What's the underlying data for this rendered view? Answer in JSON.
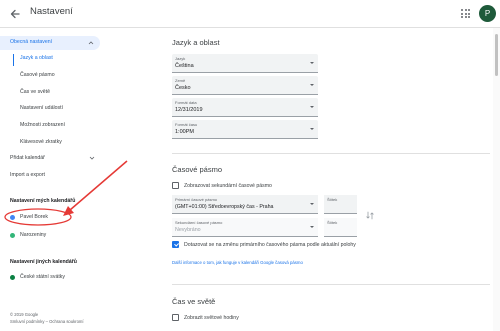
{
  "header": {
    "title": "Nastavení",
    "avatar_initial": "P"
  },
  "sidebar": {
    "general": {
      "label": "Obecná nastavení",
      "items": [
        {
          "label": "Jazyk a oblast",
          "active": true
        },
        {
          "label": "Časové pásmo"
        },
        {
          "label": "Čas ve světě"
        },
        {
          "label": "Nastavení událostí"
        },
        {
          "label": "Možnosti zobrazení"
        },
        {
          "label": "Klávesové zkratky"
        }
      ]
    },
    "add_calendar": "Přidat kalendář",
    "import_export": "Import a export",
    "my_calendars_heading": "Nastavení mých kalendářů",
    "my_calendars": [
      {
        "label": "Pavel Borek",
        "color": "#4285f4"
      },
      {
        "label": "Narozeniny",
        "color": "#33b679"
      }
    ],
    "other_calendars_heading": "Nastavení jiných kalendářů",
    "other_calendars": [
      {
        "label": "České státní svátky",
        "color": "#0b8043"
      }
    ],
    "footer": {
      "copyright": "© 2019 Google",
      "links": "Smluvní podmínky – Ochrana soukromí"
    }
  },
  "language_region": {
    "title": "Jazyk a oblast",
    "fields": [
      {
        "label": "Jazyk",
        "value": "Čeština"
      },
      {
        "label": "Země",
        "value": "Česko"
      },
      {
        "label": "Formát data",
        "value": "12/31/2019"
      },
      {
        "label": "Formát času",
        "value": "1:00PM"
      }
    ]
  },
  "timezone": {
    "title": "Časové pásmo",
    "secondary_checkbox": "Zobrazovat sekundární časové pásmo",
    "secondary_checked": false,
    "primary_label": "Primární časové pásmo",
    "primary_value": "(GMT+01:00) Středoevropský čas - Praha",
    "primary_tag_label": "Štítek",
    "secondary_label": "Sekundární časové pásmo",
    "secondary_value": "Nevybráno",
    "secondary_tag_label": "Štítek",
    "ask_checkbox": "Dotazovat se na změnu primárního časového pásma podle aktuální polohy",
    "ask_checked": true,
    "link": "Další informace o tom, jak funguje v kalendáři Google časová pásmo"
  },
  "world_clock": {
    "title": "Čas ve světě",
    "checkbox": "Zobrazit světové hodiny",
    "checked": false
  },
  "colors": {
    "accent": "#1a73e8",
    "annotation": "#e53935"
  }
}
